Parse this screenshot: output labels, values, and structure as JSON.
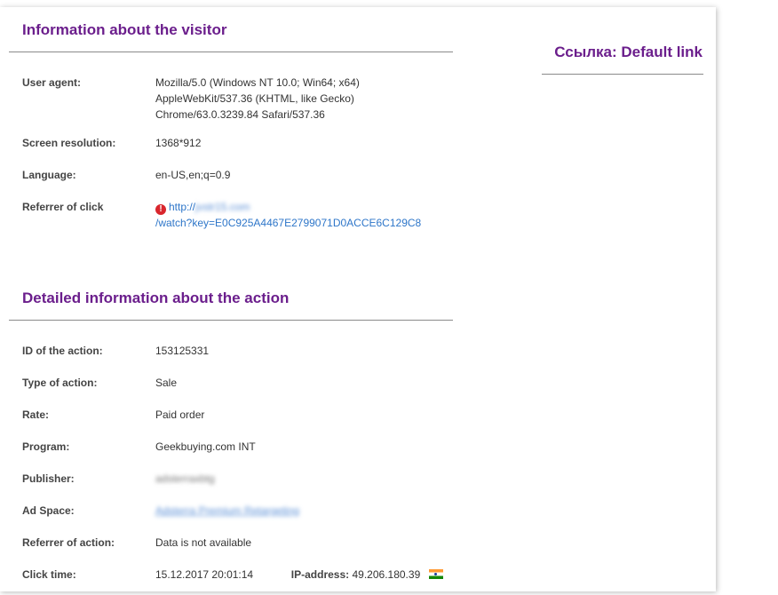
{
  "visitor": {
    "title": "Information about the visitor",
    "user_agent_label": "User agent:",
    "user_agent_line1": "Mozilla/5.0 (Windows NT 10.0; Win64; x64)",
    "user_agent_line2": "AppleWebKit/537.36 (KHTML, like Gecko)",
    "user_agent_line3": "Chrome/63.0.3239.84 Safari/537.36",
    "screen_label": "Screen resolution:",
    "screen_value": "1368*912",
    "language_label": "Language:",
    "language_value": "en-US,en;q=0.9",
    "referrer_label": "Referrer of click",
    "referrer_prefix": "http://",
    "referrer_host_blurred": "jvstr15.com",
    "referrer_path": "/watch?key=E0C925A4467E2799071D0ACCE6C129C8"
  },
  "side": {
    "title": "Ссылка: Default link"
  },
  "action": {
    "title": "Detailed information about the action",
    "rows": [
      {
        "label": "ID of the action:",
        "value": "153125331"
      },
      {
        "label": "Type of action:",
        "value": "Sale"
      },
      {
        "label": "Rate:",
        "value": "Paid order"
      },
      {
        "label": "Program:",
        "value": "Geekbuying.com INT"
      },
      {
        "label": "Publisher:",
        "value": "adsterraxbtg"
      },
      {
        "label": "Ad Space:",
        "value": "Adsterra Premium Retargeting"
      },
      {
        "label": "Referrer of action:",
        "value": "Data is not available"
      }
    ],
    "click_time_label": "Click time:",
    "click_time_value": "15.12.2017 20:01:14",
    "ip_label": "IP-address:",
    "ip_value": "49.206.180.39"
  },
  "colors": {
    "title": "#6b1e8c",
    "link": "#2e76c9",
    "warning": "#d9262d"
  },
  "icons": {
    "referrer_warning": "warning-icon",
    "country_flag": "india-flag-icon"
  }
}
